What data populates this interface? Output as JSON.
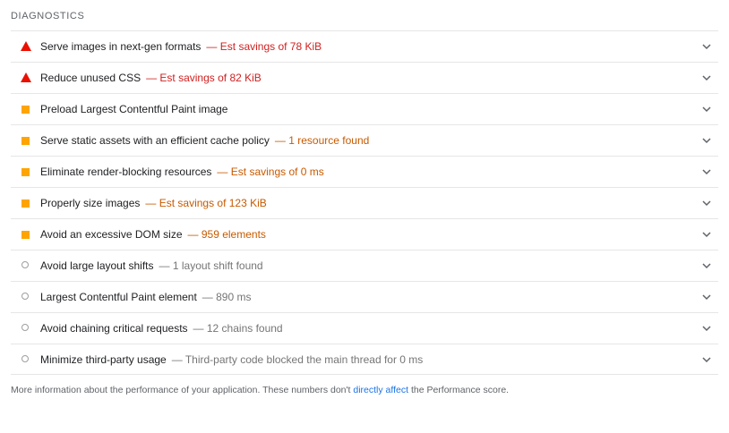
{
  "section_title": "DIAGNOSTICS",
  "audits": [
    {
      "label": "Serve images in next-gen formats",
      "separator": "—",
      "detail": "Est savings of 78 KiB",
      "status": "fail",
      "status_icon": "red-triangle-icon",
      "detail_color": "red"
    },
    {
      "label": "Reduce unused CSS",
      "separator": "—",
      "detail": "Est savings of 82 KiB",
      "status": "fail",
      "status_icon": "red-triangle-icon",
      "detail_color": "red"
    },
    {
      "label": "Preload Largest Contentful Paint image",
      "separator": "",
      "detail": "",
      "status": "average",
      "status_icon": "orange-square-icon",
      "detail_color": "orange"
    },
    {
      "label": "Serve static assets with an efficient cache policy",
      "separator": "—",
      "detail": "1 resource found",
      "status": "average",
      "status_icon": "orange-square-icon",
      "detail_color": "orange"
    },
    {
      "label": "Eliminate render-blocking resources",
      "separator": "—",
      "detail": "Est savings of 0 ms",
      "status": "average",
      "status_icon": "orange-square-icon",
      "detail_color": "orange"
    },
    {
      "label": "Properly size images",
      "separator": "—",
      "detail": "Est savings of 123 KiB",
      "status": "average",
      "status_icon": "orange-square-icon",
      "detail_color": "orange"
    },
    {
      "label": "Avoid an excessive DOM size",
      "separator": "—",
      "detail": "959 elements",
      "status": "average",
      "status_icon": "orange-square-icon",
      "detail_color": "orange"
    },
    {
      "label": "Avoid large layout shifts",
      "separator": "—",
      "detail": "1 layout shift found",
      "status": "info",
      "status_icon": "gray-circle-icon",
      "detail_color": "gray"
    },
    {
      "label": "Largest Contentful Paint element",
      "separator": "—",
      "detail": "890 ms",
      "status": "info",
      "status_icon": "gray-circle-icon",
      "detail_color": "gray"
    },
    {
      "label": "Avoid chaining critical requests",
      "separator": "—",
      "detail": "12 chains found",
      "status": "info",
      "status_icon": "gray-circle-icon",
      "detail_color": "gray"
    },
    {
      "label": "Minimize third-party usage",
      "separator": "—",
      "detail": "Third-party code blocked the main thread for 0 ms",
      "status": "info",
      "status_icon": "gray-circle-icon",
      "detail_color": "gray"
    }
  ],
  "footer": {
    "before_link": "More information about the performance of your application. These numbers don't ",
    "link_text": "directly affect",
    "after_link": " the Performance score."
  },
  "colors": {
    "fail": "#eb0f00",
    "average": "#ffa400",
    "info": "#9e9e9e",
    "link": "#1a73e8"
  }
}
